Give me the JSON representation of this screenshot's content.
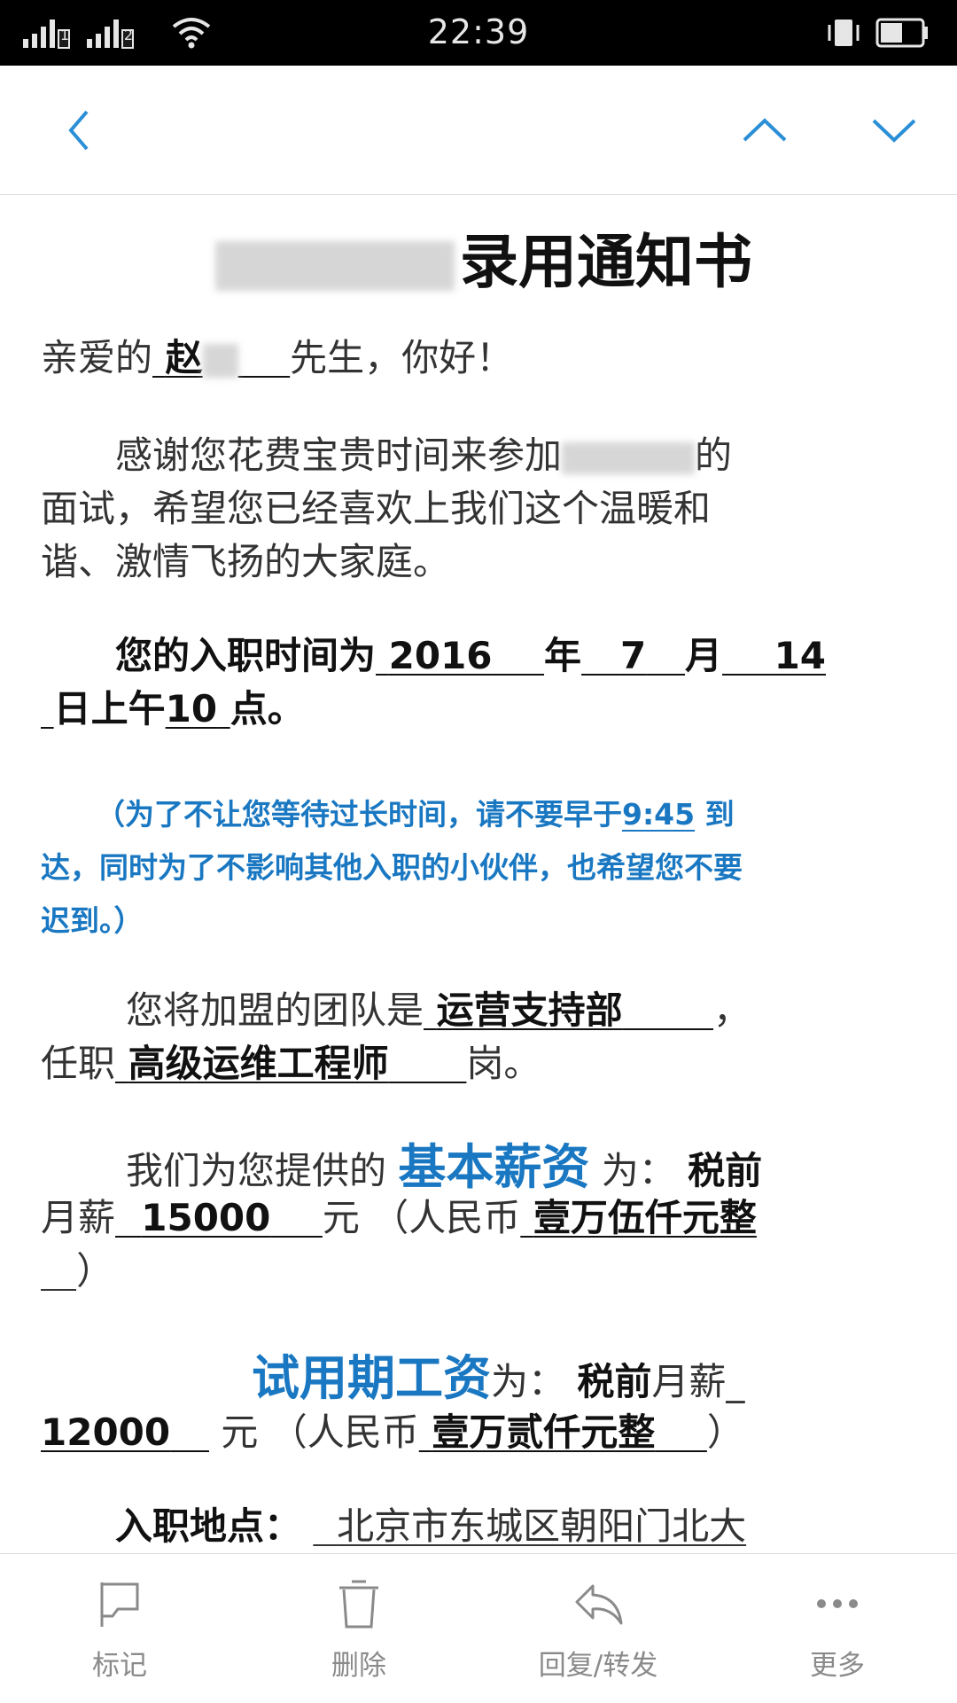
{
  "status_bar": {
    "time": "22:39",
    "sim1_label": "1",
    "sim2_label": "2",
    "icons": [
      "signal-icon",
      "wifi-icon",
      "vibrate-icon",
      "battery-icon"
    ]
  },
  "nav": {
    "icons": [
      "back-icon",
      "prev-icon",
      "next-icon"
    ],
    "accent_color": "#2a8fd6"
  },
  "letter": {
    "title": "录用通知书",
    "greeting": {
      "prefix": "亲爱的",
      "name": "赵",
      "suffix": "先生，你好！"
    },
    "para1": {
      "line1_a": "感谢您花费宝贵时间来参加",
      "line1_b": "的",
      "line2": "面试，希望您已经喜欢上我们这个温暖和",
      "line3": "谐、激情飞扬的大家庭。"
    },
    "start": {
      "prefix": "您的入职时间为",
      "year": "2016",
      "year_unit": "年",
      "month": "7",
      "month_unit": "月",
      "day": "14",
      "day_unit": "日上午",
      "hour": "10",
      "hour_unit": "点。"
    },
    "note": {
      "line1_a": "（为了不让您等待过长时间，请不要早于",
      "time": "9:45",
      "line1_b": "到",
      "line2": "达，同时为了不影响其他入职的小伙伴，也希望您不要",
      "line3": "迟到。）"
    },
    "team": {
      "prefix": "您将加盟的团队是",
      "team_name": "运营支持部",
      "comma": "，",
      "role_prefix": "任职",
      "role": "高级运维工程师",
      "role_suffix": "岗。"
    },
    "salary": {
      "prefix": "我们为您提供的",
      "label": "基本薪资",
      "mid": "为：",
      "pretax": "税前",
      "line2_a": "月薪",
      "amount": "15000",
      "line2_b": "元 （人民币",
      "amount_cn": "壹万伍仟元整",
      "close": "）"
    },
    "probation": {
      "label": "试用期工资",
      "mid": "为：",
      "pretax": "税前",
      "monthly": "月薪_",
      "amount": "12000",
      "line2_b": "元 （人民币",
      "amount_cn": "壹万贰仟元整",
      "close": "）"
    },
    "location": {
      "label": "入职地点：",
      "address": "北京市东城区朝阳门北大"
    }
  },
  "toolbar": {
    "flag": "标记",
    "delete": "删除",
    "reply": "回复/转发",
    "more": "更多",
    "icons": [
      "flag-icon",
      "trash-icon",
      "reply-icon",
      "more-icon"
    ]
  }
}
